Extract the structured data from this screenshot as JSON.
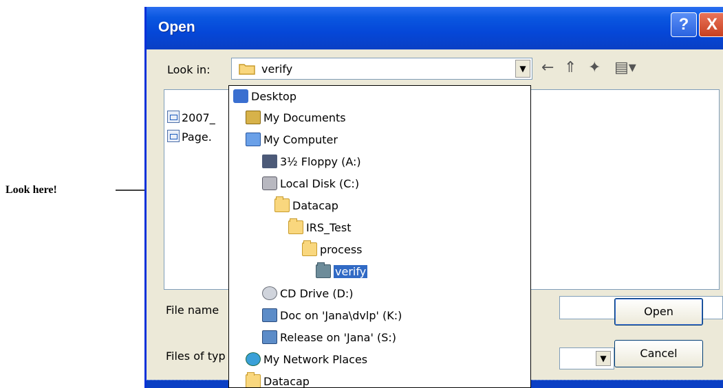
{
  "annotation": {
    "text": "Look here!"
  },
  "dialog": {
    "title": "Open",
    "help_label": "?",
    "close_label": "X",
    "look_in_label": "Look in:",
    "look_in_value": "verify",
    "files": [
      {
        "name": "2007_"
      },
      {
        "name": "Page."
      }
    ],
    "file_name_label": "File name",
    "files_of_type_label": "Files of typ",
    "open_label": "Open",
    "cancel_label": "Cancel",
    "dropdown_arrow": "▼"
  },
  "toolbar": {
    "back_icon": "←",
    "up_icon": "⇑",
    "new_folder_icon": "✦",
    "view_icon": "▤▾"
  },
  "dropdown": {
    "items": [
      {
        "label": "Desktop",
        "icon": "desktop-icon",
        "indent": 0
      },
      {
        "label": "My Documents",
        "icon": "documents-icon",
        "indent": 1
      },
      {
        "label": "My Computer",
        "icon": "computer-icon",
        "indent": 1
      },
      {
        "label": "3½ Floppy (A:)",
        "icon": "floppy-icon",
        "indent": 2
      },
      {
        "label": "Local Disk (C:)",
        "icon": "disk-icon",
        "indent": 2
      },
      {
        "label": "Datacap",
        "icon": "folder-icon",
        "indent": 3
      },
      {
        "label": "IRS_Test",
        "icon": "folder-icon",
        "indent": 4
      },
      {
        "label": "process",
        "icon": "folder-icon",
        "indent": 5
      },
      {
        "label": "verify",
        "icon": "folder-open-icon",
        "indent": 6,
        "selected": true
      },
      {
        "label": "CD Drive (D:)",
        "icon": "cd-drive-icon",
        "indent": 2
      },
      {
        "label": "Doc on 'Jana\\dvlp' (K:)",
        "icon": "network-drive-icon",
        "indent": 2
      },
      {
        "label": "Release on 'Jana' (S:)",
        "icon": "network-drive-icon",
        "indent": 2
      },
      {
        "label": "My Network Places",
        "icon": "network-places-icon",
        "indent": 1
      },
      {
        "label": "Datacap",
        "icon": "folder-icon",
        "indent": 1
      }
    ]
  }
}
